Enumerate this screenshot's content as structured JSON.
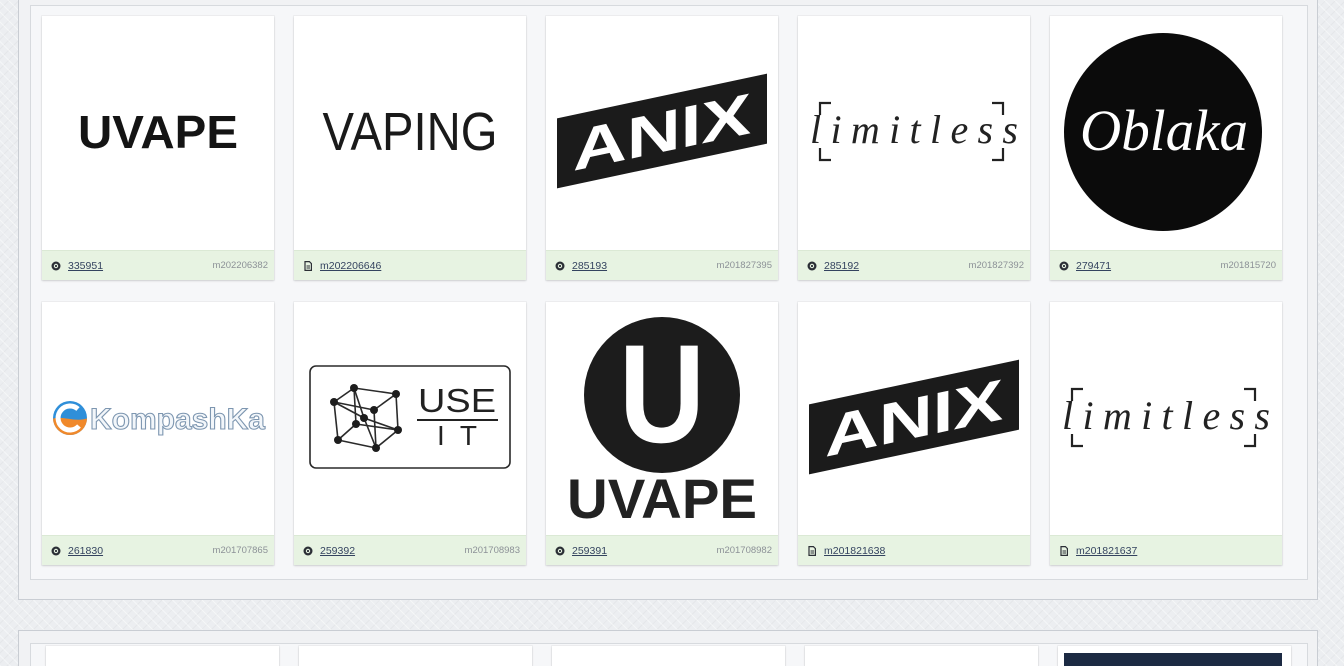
{
  "colors": {
    "footer_bg": "#e7f3e2",
    "link_text": "#34435f",
    "app_no_text": "#8c9197"
  },
  "panels": [
    {
      "cards": [
        {
          "logo": {
            "logo_icon": "bold-wordmark-logo",
            "text": "UVAPE"
          },
          "status_icon": "registered-icon",
          "number": "335951",
          "app_no": "m202206382"
        },
        {
          "logo": {
            "logo_icon": "regular-wordmark-logo",
            "text": "VAPING"
          },
          "status_icon": "document-icon",
          "number": "m202206646"
        },
        {
          "logo": {
            "logo_icon": "skewed-banner-logo",
            "text": "ANIX"
          },
          "status_icon": "registered-icon",
          "number": "285193",
          "app_no": "m201827395"
        },
        {
          "logo": {
            "logo_icon": "bracketed-script-logo",
            "text": "limitless"
          },
          "status_icon": "registered-icon",
          "number": "285192",
          "app_no": "m201827392"
        },
        {
          "logo": {
            "logo_icon": "circle-script-logo",
            "text": "Oblaka"
          },
          "status_icon": "registered-icon",
          "number": "279471",
          "app_no": "m201815720"
        },
        {
          "logo": {
            "logo_icon": "compass-wordmark-logo",
            "text": "KompashKa",
            "colors": {
              "emblem_top": "#2f8fd9",
              "emblem_bottom": "#f0892b",
              "outline": "#7d96b0"
            }
          },
          "status_icon": "registered-icon",
          "number": "261830",
          "app_no": "m201707865"
        },
        {
          "logo": {
            "logo_icon": "network-box-logo",
            "text": "USE",
            "text2": "IT"
          },
          "status_icon": "registered-icon",
          "number": "259392",
          "app_no": "m201708983"
        },
        {
          "logo": {
            "logo_icon": "circle-letter-wordmark-logo",
            "letter": "U",
            "text": "UVAPE"
          },
          "status_icon": "registered-icon",
          "number": "259391",
          "app_no": "m201708982"
        },
        {
          "logo": {
            "logo_icon": "skewed-banner-logo",
            "text": "ANIX"
          },
          "status_icon": "document-icon",
          "number": "m201821638"
        },
        {
          "logo": {
            "logo_icon": "bracketed-script-logo",
            "text": "limitless"
          },
          "status_icon": "document-icon",
          "number": "m201821637"
        }
      ]
    },
    {
      "cards": [
        {},
        {},
        {},
        {},
        {
          "logo": {
            "logo_icon": "dark-logo-image",
            "color": "#1c2a43"
          }
        }
      ]
    }
  ]
}
